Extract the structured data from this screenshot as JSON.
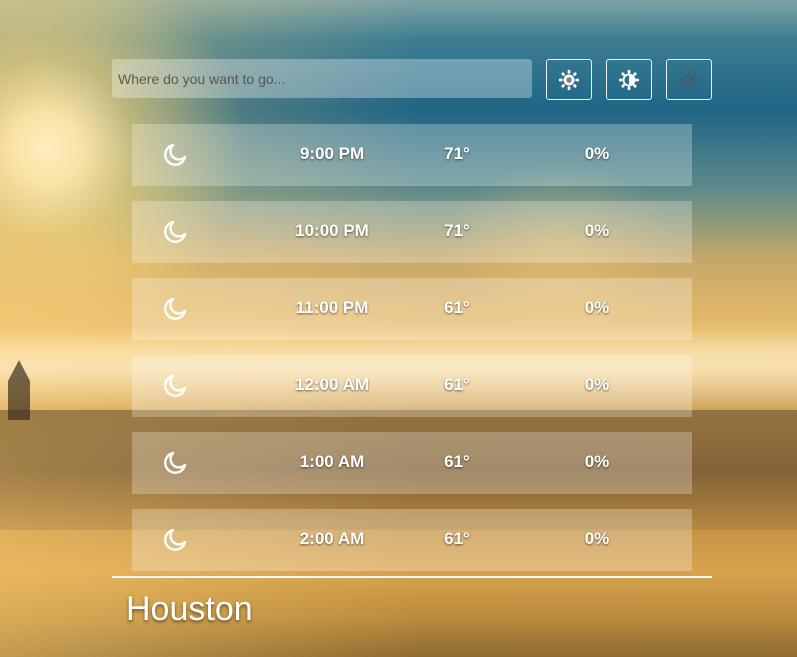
{
  "search": {
    "placeholder": "Where do you want to go...",
    "value": ""
  },
  "toolbar": [
    {
      "icon": "sun-icon"
    },
    {
      "icon": "contrast-icon"
    },
    {
      "icon": "sun-icon"
    }
  ],
  "forecast": [
    {
      "icon": "moon-icon",
      "time": "9:00 PM",
      "temp": "71°",
      "precip": "0%"
    },
    {
      "icon": "moon-icon",
      "time": "10:00 PM",
      "temp": "71°",
      "precip": "0%"
    },
    {
      "icon": "moon-icon",
      "time": "11:00 PM",
      "temp": "61°",
      "precip": "0%"
    },
    {
      "icon": "moon-icon",
      "time": "12:00 AM",
      "temp": "61°",
      "precip": "0%"
    },
    {
      "icon": "moon-icon",
      "time": "1:00 AM",
      "temp": "61°",
      "precip": "0%"
    },
    {
      "icon": "moon-icon",
      "time": "2:00 AM",
      "temp": "61°",
      "precip": "0%"
    }
  ],
  "city": "Houston"
}
